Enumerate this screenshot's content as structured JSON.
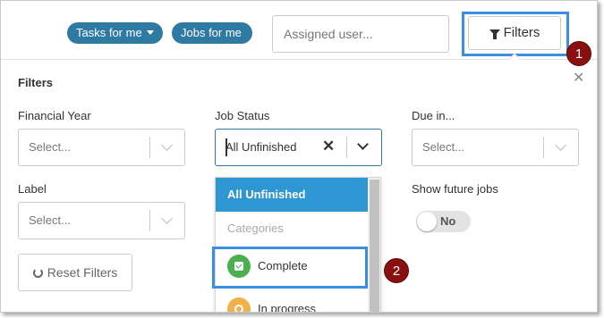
{
  "topbar": {
    "tasks_pill": "Tasks for me",
    "jobs_pill": "Jobs for me",
    "assigned_placeholder": "Assigned user...",
    "filters_button": "Filters"
  },
  "annotations": {
    "step1": "1",
    "step2": "2",
    "highlight_color": "#3a8fe0",
    "badge_color": "#8a1010"
  },
  "panel": {
    "title": "Filters",
    "close_icon": "close-icon",
    "financial_year": {
      "label": "Financial Year",
      "placeholder": "Select..."
    },
    "job_status": {
      "label": "Job Status",
      "value": "All Unfinished"
    },
    "due_in": {
      "label": "Due in...",
      "placeholder": "Select..."
    },
    "label_field": {
      "label": "Label",
      "placeholder": "Select..."
    },
    "show_future_jobs": {
      "label": "Show future jobs",
      "value": "No"
    },
    "reset_button": "Reset Filters"
  },
  "dropdown": {
    "options": [
      {
        "label": "All Unfinished",
        "selected": true
      },
      {
        "label": "Categories",
        "group_header": true
      },
      {
        "label": "Complete",
        "icon": "check-icon",
        "color": "#4caf50"
      },
      {
        "label": "In progress",
        "icon": "in-progress-icon",
        "color": "#f0b04a"
      }
    ]
  },
  "colors": {
    "accent": "#2e7aa2",
    "selected_option": "#2f96d4"
  }
}
